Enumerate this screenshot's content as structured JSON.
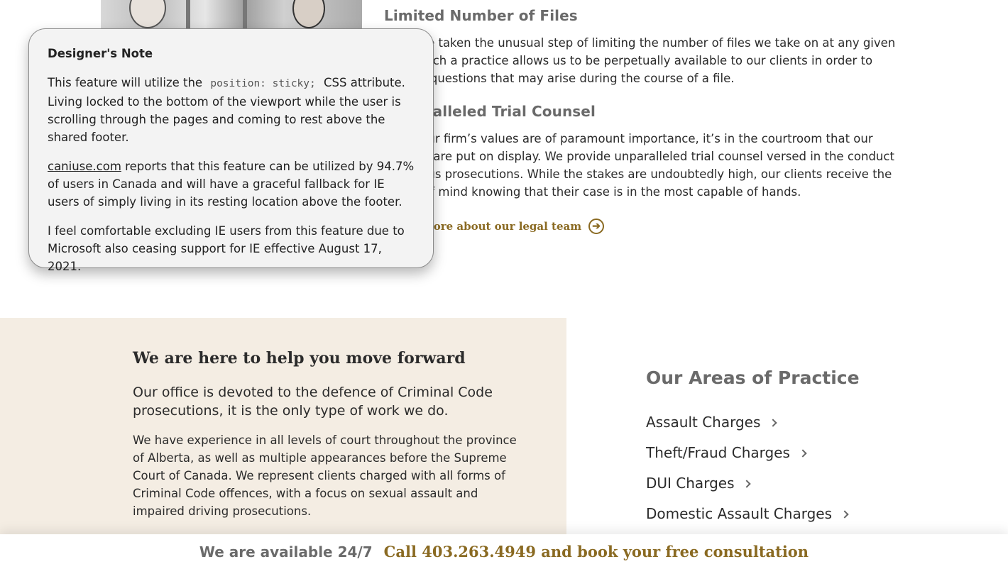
{
  "content": {
    "section1": {
      "heading": "Limited Number of Files",
      "text": "We have taken the unusual step of limiting the number of files we take on at any given time. Such a practice allows us to be perpetually available to our clients in order to answer questions that may arise during the course of a file."
    },
    "section2": {
      "heading": "Unparalleled Trial Counsel",
      "text": "While our firm’s values are of paramount importance, it’s in the courtroom that our abilities are put on display. We provide unparalleled trial counsel versed in the conduct of serious prosecutions. While the stakes are undoubtedly high, our clients receive the peace of mind knowing that their case is in the most capable of hands."
    },
    "learn_more": "Learn more about our legal team"
  },
  "note": {
    "title": "Designer's Note",
    "p1_before": "This feature will utilize the",
    "p1_code": "position: sticky;",
    "p1_after": "CSS attribute. Living locked to the bottom of the viewport while the user is scrolling through the pages and coming to rest above the shared footer.",
    "p2_link": "caniuse.com",
    "p2_after": "reports that this feature can be utilized by 94.7% of users in Canada and will have a graceful fallback for IE users of simply living in its resting location above the footer.",
    "p3": "I feel comfortable excluding IE users from this feature due to Microsoft also ceasing support for IE effective August 17, 2021."
  },
  "help": {
    "heading": "We are here to help you move forward",
    "lead": "Our office is devoted to the defence of Criminal Code prosecutions, it is the only type of work we do.",
    "body": "We have experience in all levels of court throughout the province of Alberta, as well as multiple appearances before the Supreme Court of Canada. We represent clients charged with all forms of Criminal Code offences, with a focus on sexual assault and impaired driving prosecutions."
  },
  "areas": {
    "heading": "Our Areas of Practice",
    "items": [
      "Assault Charges",
      "Theft/Fraud Charges",
      "DUI Charges",
      "Domestic Assault Charges"
    ]
  },
  "sticky": {
    "available": "We are available 24/7",
    "call": "Call 403.263.4949 and book your free consultation"
  },
  "colors": {
    "accent_gold": "#8a6a22",
    "panel_beige": "#f4ede3"
  }
}
